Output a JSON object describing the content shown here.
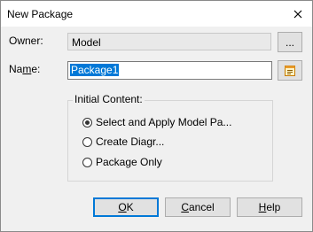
{
  "window": {
    "title": "New Package"
  },
  "form": {
    "owner_label": "Owner:",
    "owner_value": "Model",
    "browse_label": "...",
    "name_label_prefix": "Na",
    "name_label_underlined": "m",
    "name_label_suffix": "e:",
    "name_value": "Package1"
  },
  "initial_content": {
    "title": "Initial Content:",
    "options": [
      {
        "label": "Select and Apply Model Pa...",
        "selected": true
      },
      {
        "label": "Create Diagr...",
        "selected": false
      },
      {
        "label": "Package Only",
        "selected": false
      }
    ]
  },
  "buttons": {
    "ok": {
      "underlined": "O",
      "rest": "K"
    },
    "cancel": {
      "underlined": "C",
      "rest": "ancel"
    },
    "help": {
      "underlined": "H",
      "rest": "elp"
    }
  },
  "colors": {
    "selection": "#0078d7",
    "dialog_bg": "#f0f0f0"
  },
  "icons": {
    "close": "close-icon",
    "notes": "notes-icon"
  }
}
